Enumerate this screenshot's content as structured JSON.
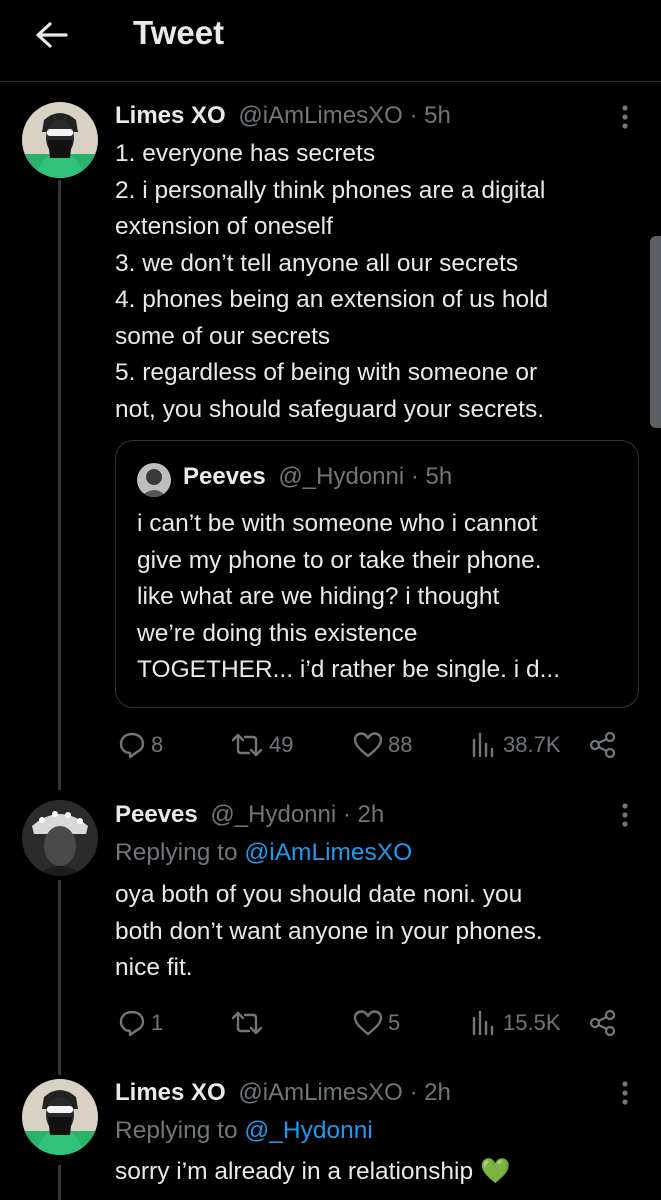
{
  "header": {
    "title": "Tweet"
  },
  "main_tweet": {
    "display_name": "Limes XO",
    "handle": "@iAmLimesXO",
    "separator": " · ",
    "time": "5h",
    "lines": [
      "1. everyone has secrets",
      "2. i personally think phones are a digital",
      "extension of oneself",
      "3. we don’t tell anyone all our secrets",
      "4. phones being an extension of us hold",
      "some of our secrets",
      "5. regardless of being with someone or",
      "not, you should safeguard your secrets."
    ],
    "quote": {
      "display_name": "Peeves",
      "handle": "@_Hydonni",
      "separator": " · ",
      "time": "5h",
      "lines": [
        "i can’t be with someone who i cannot",
        "give my phone to or take their phone.",
        "like what are we hiding? i thought",
        "we’re doing this existence",
        "TOGETHER... i’d rather be single. i d..."
      ]
    },
    "stats": {
      "replies": "8",
      "retweets": "49",
      "likes": "88",
      "views": "38.7K"
    }
  },
  "reply_1": {
    "display_name": "Peeves",
    "handle": "@_Hydonni",
    "separator": " · ",
    "time": "2h",
    "replying_prefix": "Replying to ",
    "replying_to": "@iAmLimesXO",
    "lines": [
      "oya both of you should date noni. you",
      "both don’t want anyone in your phones.",
      "nice fit."
    ],
    "stats": {
      "replies": "1",
      "retweets": "",
      "likes": "5",
      "views": "15.5K"
    }
  },
  "reply_2": {
    "display_name": "Limes XO",
    "handle": "@iAmLimesXO",
    "separator": " · ",
    "time": "2h",
    "replying_prefix": "Replying to ",
    "replying_to": "@_Hydonni",
    "lines": [
      "sorry i’m already in a relationship"
    ],
    "emoji": "💚"
  },
  "colors": {
    "background": "#000000",
    "text": "#e7e9ea",
    "muted": "#71767b",
    "link": "#1d9bf0",
    "border": "#2f3336",
    "heart_emoji": "#5cb85c"
  },
  "icons": {
    "back": "arrow-left-icon",
    "more": "more-vertical-icon",
    "reply": "reply-icon",
    "retweet": "retweet-icon",
    "like": "heart-icon",
    "views": "views-chart-icon",
    "share": "share-icon"
  }
}
